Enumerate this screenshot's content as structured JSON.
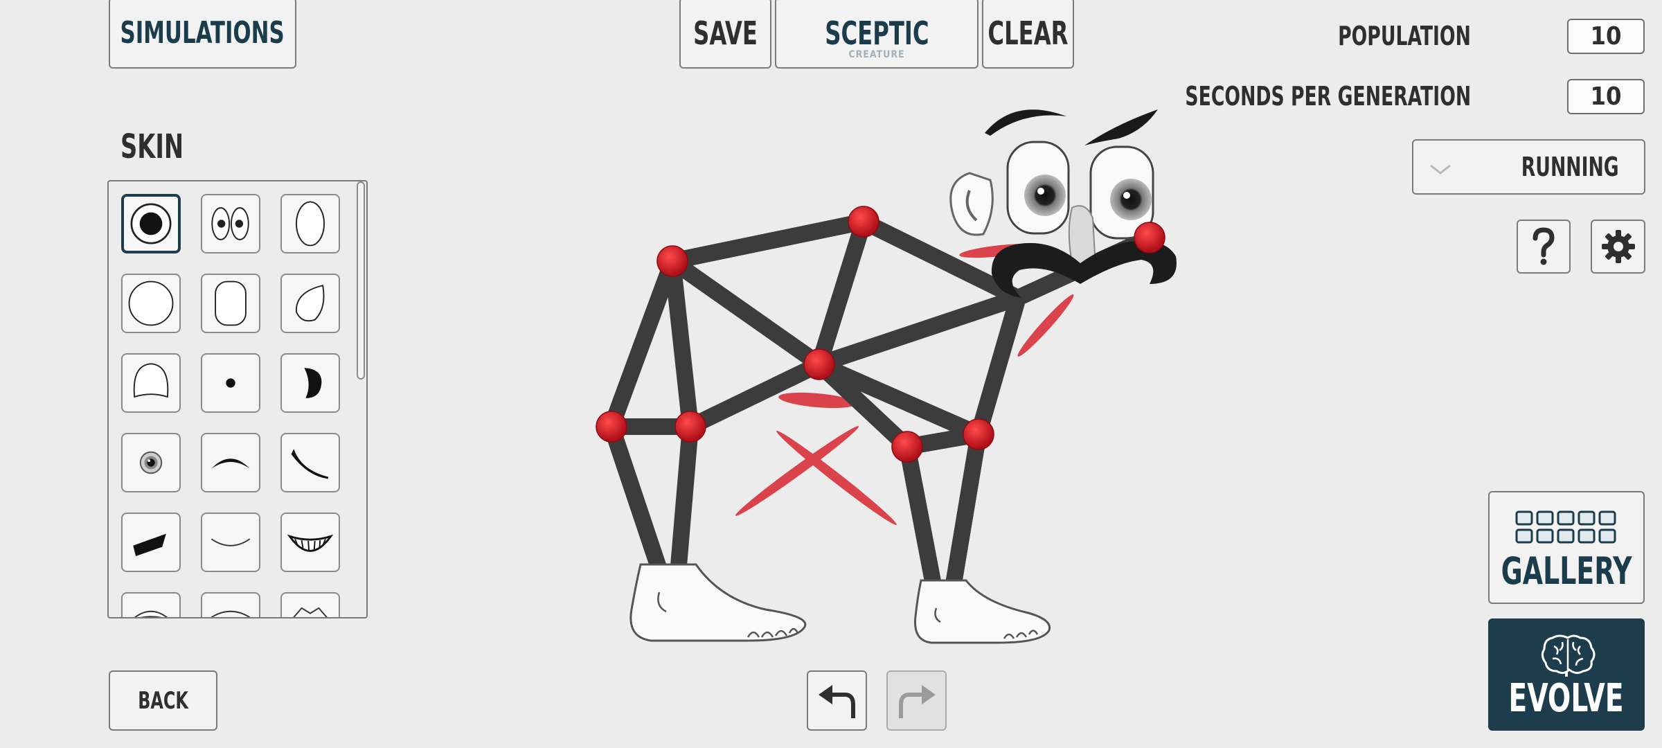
{
  "top_bar": {
    "simulations_label": "SIMULATIONS",
    "save_label": "SAVE",
    "creature_name": "SCEPTIC",
    "creature_caption": "CREATURE",
    "clear_label": "CLEAR"
  },
  "settings": {
    "population_label": "POPULATION",
    "population_value": "10",
    "seconds_label": "SECONDS PER GENERATION",
    "seconds_value": "10",
    "task_value": "RUNNING"
  },
  "skin_panel": {
    "title": "SKIN",
    "items": [
      "big-pupil-eye",
      "pair-of-eyes",
      "oval-eye",
      "round-eye",
      "rounded-square-eye",
      "tilted-eye",
      "half-eye",
      "small-dot-pupil",
      "crescent-pupil",
      "realistic-eye",
      "eyebrow-arch",
      "eyebrow-slant",
      "eyebrow-thick",
      "smile-thin",
      "toothy-grin",
      "mouth-lips",
      "mouth-open",
      "mouth-pout"
    ],
    "selected_index": 0
  },
  "bottom": {
    "back_label": "BACK",
    "undo_icon": "undo-arrow-icon",
    "redo_icon": "redo-arrow-icon"
  },
  "right_actions": {
    "gallery_label": "GALLERY",
    "evolve_label": "EVOLVE",
    "help_icon": "question-mark-icon",
    "settings_icon": "gear-icon",
    "brain_icon": "brain-icon",
    "gallery_icon": "grid-icon"
  },
  "colors": {
    "accent": "#1e3d4c",
    "joint": "#c8141c",
    "bone": "#3c3c3c",
    "muscle": "#d8343c",
    "background": "#ececec"
  }
}
